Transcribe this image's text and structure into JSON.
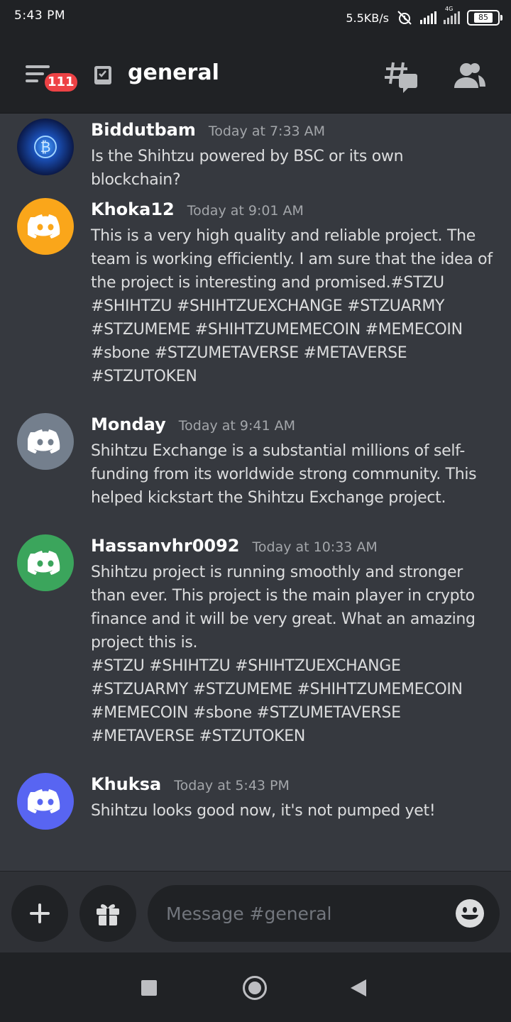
{
  "status_bar": {
    "time": "5:43 PM",
    "network_speed": "5.5KB/s",
    "network_type": "4G",
    "battery": "85"
  },
  "header": {
    "unread_count": "111",
    "channel_name": "general"
  },
  "messages": [
    {
      "username": "Biddutbam",
      "timestamp": "Today at 7:33 AM",
      "content": "Is the Shihtzu powered by BSC or its own blockchain?",
      "avatar_color": "#0b1a4a"
    },
    {
      "username": "Khoka12",
      "timestamp": "Today at 9:01 AM",
      "content": "This is a very high quality and reliable project. The team is working efficiently. I am sure that the idea of the project is interesting and promised.#STZU #SHIHTZU #SHIHTZUEXCHANGE #STZUARMY #STZUMEME #SHIHTZUMEMECOIN #MEMECOIN #sbone #STZUMETAVERSE #METAVERSE #STZUTOKEN",
      "avatar_color": "#faa61a"
    },
    {
      "username": "Monday",
      "timestamp": "Today at 9:41 AM",
      "content": "Shihtzu Exchange is a substantial millions of self-funding from its worldwide strong community. This helped kickstart the Shihtzu Exchange project.",
      "avatar_color": "#747f8d"
    },
    {
      "username": "Hassanvhr0092",
      "timestamp": "Today at 10:33 AM",
      "content": "Shihtzu project is running smoothly and stronger than ever. This project is the main player in crypto finance and it will be very great. What an amazing project this is.\n#STZU #SHIHTZU #SHIHTZUEXCHANGE #STZUARMY #STZUMEME #SHIHTZUMEMECOIN #MEMECOIN #sbone #STZUMETAVERSE #METAVERSE #STZUTOKEN",
      "avatar_color": "#3ba55c"
    },
    {
      "username": "Khuksa",
      "timestamp": "Today at 5:43 PM",
      "content": "Shihtzu looks good now, it's not pumped yet!",
      "avatar_color": "#5865f2"
    }
  ],
  "composer": {
    "placeholder": "Message #general"
  },
  "colors": {
    "background": "#36393f",
    "header_bg": "#202225",
    "badge": "#ed4245"
  }
}
